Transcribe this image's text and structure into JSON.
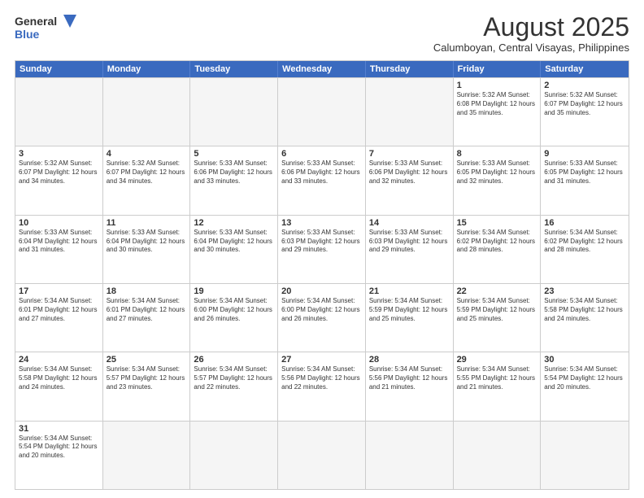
{
  "logo": {
    "line1": "General",
    "line2": "Blue"
  },
  "title": "August 2025",
  "subtitle": "Calumboyan, Central Visayas, Philippines",
  "header_days": [
    "Sunday",
    "Monday",
    "Tuesday",
    "Wednesday",
    "Thursday",
    "Friday",
    "Saturday"
  ],
  "weeks": [
    [
      {
        "day": "",
        "info": ""
      },
      {
        "day": "",
        "info": ""
      },
      {
        "day": "",
        "info": ""
      },
      {
        "day": "",
        "info": ""
      },
      {
        "day": "",
        "info": ""
      },
      {
        "day": "1",
        "info": "Sunrise: 5:32 AM\nSunset: 6:08 PM\nDaylight: 12 hours\nand 35 minutes."
      },
      {
        "day": "2",
        "info": "Sunrise: 5:32 AM\nSunset: 6:07 PM\nDaylight: 12 hours\nand 35 minutes."
      }
    ],
    [
      {
        "day": "3",
        "info": "Sunrise: 5:32 AM\nSunset: 6:07 PM\nDaylight: 12 hours\nand 34 minutes."
      },
      {
        "day": "4",
        "info": "Sunrise: 5:32 AM\nSunset: 6:07 PM\nDaylight: 12 hours\nand 34 minutes."
      },
      {
        "day": "5",
        "info": "Sunrise: 5:33 AM\nSunset: 6:06 PM\nDaylight: 12 hours\nand 33 minutes."
      },
      {
        "day": "6",
        "info": "Sunrise: 5:33 AM\nSunset: 6:06 PM\nDaylight: 12 hours\nand 33 minutes."
      },
      {
        "day": "7",
        "info": "Sunrise: 5:33 AM\nSunset: 6:06 PM\nDaylight: 12 hours\nand 32 minutes."
      },
      {
        "day": "8",
        "info": "Sunrise: 5:33 AM\nSunset: 6:05 PM\nDaylight: 12 hours\nand 32 minutes."
      },
      {
        "day": "9",
        "info": "Sunrise: 5:33 AM\nSunset: 6:05 PM\nDaylight: 12 hours\nand 31 minutes."
      }
    ],
    [
      {
        "day": "10",
        "info": "Sunrise: 5:33 AM\nSunset: 6:04 PM\nDaylight: 12 hours\nand 31 minutes."
      },
      {
        "day": "11",
        "info": "Sunrise: 5:33 AM\nSunset: 6:04 PM\nDaylight: 12 hours\nand 30 minutes."
      },
      {
        "day": "12",
        "info": "Sunrise: 5:33 AM\nSunset: 6:04 PM\nDaylight: 12 hours\nand 30 minutes."
      },
      {
        "day": "13",
        "info": "Sunrise: 5:33 AM\nSunset: 6:03 PM\nDaylight: 12 hours\nand 29 minutes."
      },
      {
        "day": "14",
        "info": "Sunrise: 5:33 AM\nSunset: 6:03 PM\nDaylight: 12 hours\nand 29 minutes."
      },
      {
        "day": "15",
        "info": "Sunrise: 5:34 AM\nSunset: 6:02 PM\nDaylight: 12 hours\nand 28 minutes."
      },
      {
        "day": "16",
        "info": "Sunrise: 5:34 AM\nSunset: 6:02 PM\nDaylight: 12 hours\nand 28 minutes."
      }
    ],
    [
      {
        "day": "17",
        "info": "Sunrise: 5:34 AM\nSunset: 6:01 PM\nDaylight: 12 hours\nand 27 minutes."
      },
      {
        "day": "18",
        "info": "Sunrise: 5:34 AM\nSunset: 6:01 PM\nDaylight: 12 hours\nand 27 minutes."
      },
      {
        "day": "19",
        "info": "Sunrise: 5:34 AM\nSunset: 6:00 PM\nDaylight: 12 hours\nand 26 minutes."
      },
      {
        "day": "20",
        "info": "Sunrise: 5:34 AM\nSunset: 6:00 PM\nDaylight: 12 hours\nand 26 minutes."
      },
      {
        "day": "21",
        "info": "Sunrise: 5:34 AM\nSunset: 5:59 PM\nDaylight: 12 hours\nand 25 minutes."
      },
      {
        "day": "22",
        "info": "Sunrise: 5:34 AM\nSunset: 5:59 PM\nDaylight: 12 hours\nand 25 minutes."
      },
      {
        "day": "23",
        "info": "Sunrise: 5:34 AM\nSunset: 5:58 PM\nDaylight: 12 hours\nand 24 minutes."
      }
    ],
    [
      {
        "day": "24",
        "info": "Sunrise: 5:34 AM\nSunset: 5:58 PM\nDaylight: 12 hours\nand 24 minutes."
      },
      {
        "day": "25",
        "info": "Sunrise: 5:34 AM\nSunset: 5:57 PM\nDaylight: 12 hours\nand 23 minutes."
      },
      {
        "day": "26",
        "info": "Sunrise: 5:34 AM\nSunset: 5:57 PM\nDaylight: 12 hours\nand 22 minutes."
      },
      {
        "day": "27",
        "info": "Sunrise: 5:34 AM\nSunset: 5:56 PM\nDaylight: 12 hours\nand 22 minutes."
      },
      {
        "day": "28",
        "info": "Sunrise: 5:34 AM\nSunset: 5:56 PM\nDaylight: 12 hours\nand 21 minutes."
      },
      {
        "day": "29",
        "info": "Sunrise: 5:34 AM\nSunset: 5:55 PM\nDaylight: 12 hours\nand 21 minutes."
      },
      {
        "day": "30",
        "info": "Sunrise: 5:34 AM\nSunset: 5:54 PM\nDaylight: 12 hours\nand 20 minutes."
      }
    ],
    [
      {
        "day": "31",
        "info": "Sunrise: 5:34 AM\nSunset: 5:54 PM\nDaylight: 12 hours\nand 20 minutes."
      },
      {
        "day": "",
        "info": ""
      },
      {
        "day": "",
        "info": ""
      },
      {
        "day": "",
        "info": ""
      },
      {
        "day": "",
        "info": ""
      },
      {
        "day": "",
        "info": ""
      },
      {
        "day": "",
        "info": ""
      }
    ]
  ]
}
